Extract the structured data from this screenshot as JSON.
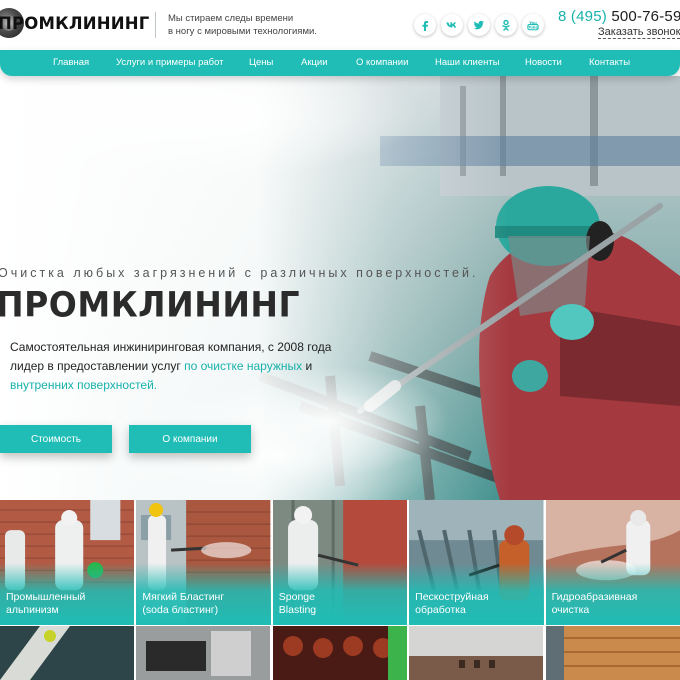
{
  "header": {
    "logo_text": "ПРОМКЛИНИНГ",
    "tagline_line1": "Мы стираем следы времени",
    "tagline_line2": "в ногу с мировыми технологиями.",
    "phone_code": "8 (495)",
    "phone_number": "500-76-59",
    "callback_label": "Заказать звонок",
    "socials": [
      {
        "name": "facebook-icon",
        "glyph": "f"
      },
      {
        "name": "vk-icon",
        "glyph": "vk"
      },
      {
        "name": "twitter-icon",
        "glyph": "t"
      },
      {
        "name": "odnoklassniki-icon",
        "glyph": "ok"
      },
      {
        "name": "youtube-icon",
        "glyph": "yt"
      }
    ]
  },
  "nav": {
    "items": [
      {
        "label": "Главная"
      },
      {
        "label": "Услуги и примеры работ"
      },
      {
        "label": "Цены"
      },
      {
        "label": "Акции"
      },
      {
        "label": "О компании"
      },
      {
        "label": "Наши клиенты"
      },
      {
        "label": "Новости"
      },
      {
        "label": "Контакты"
      }
    ]
  },
  "hero": {
    "headline": "Очистка любых загрязнений с различных поверхностей.",
    "title": "ПРОМКЛИНИНГ",
    "desc_text1": "Самостоятельная инжиниринговая компания, с 2008 года лидер в предоставлении услуг ",
    "desc_link1": "по очистке наружных",
    "desc_text2": " и ",
    "desc_link2": "внутренних поверхностей.",
    "btn_price": "Стоимость",
    "btn_about": "О компании"
  },
  "services": [
    {
      "line1": "Промышленный",
      "line2": "альпинизм"
    },
    {
      "line1": "Мягкий Бластинг",
      "line2": "(soda бластинг)"
    },
    {
      "line1": "Sponge",
      "line2": "Blasting"
    },
    {
      "line1": "Пескоструйная",
      "line2": "обработка"
    },
    {
      "line1": "Гидроабразивная",
      "line2": "очистка"
    }
  ],
  "colors": {
    "accent": "#1fbdb5",
    "accent_text": "#17b2ab",
    "title": "#2b2b2b"
  }
}
